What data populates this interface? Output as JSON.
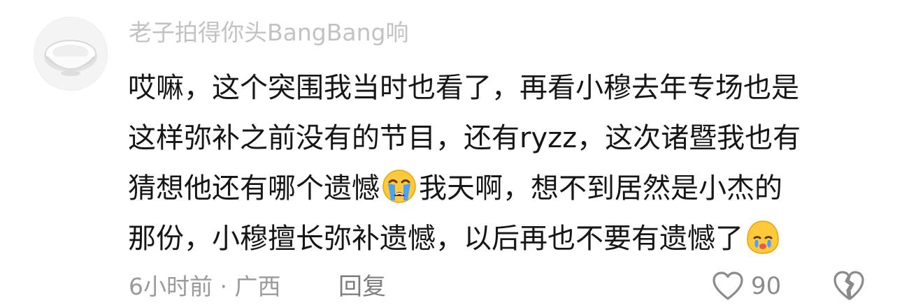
{
  "comment": {
    "username": "老子拍得你头BangBang响",
    "avatar_icon": "bowl-icon",
    "lines": [
      {
        "before": "哎嘛，这个突围我当时也看了，再看小穆去年专场也是",
        "emoji": "",
        "after": ""
      },
      {
        "before": "这样弥补之前没有的节目，还有ryzz，这次诸暨我也有",
        "emoji": "",
        "after": ""
      },
      {
        "before": "猜想他还有哪个遗憾",
        "emoji": "loudly-crying-face-icon",
        "after": "我天啊，想不到居然是小杰的"
      },
      {
        "before": "那份，小穆擅长弥补遗憾，以后再也不要有遗憾了",
        "emoji": "crying-face-icon",
        "after": ""
      }
    ],
    "meta": "6小时前 · 广西",
    "reply_label": "回复",
    "like_count": "90",
    "like_icon": "heart-outline-icon",
    "dislike_icon": "broken-heart-outline-icon"
  },
  "colors": {
    "text": "#161616",
    "username": "#c2c2c2",
    "meta": "#9a9a9a",
    "icon": "#8a8a8a",
    "emoji_yellow": "#ffc83d",
    "emoji_tear": "#4aa3f5"
  }
}
